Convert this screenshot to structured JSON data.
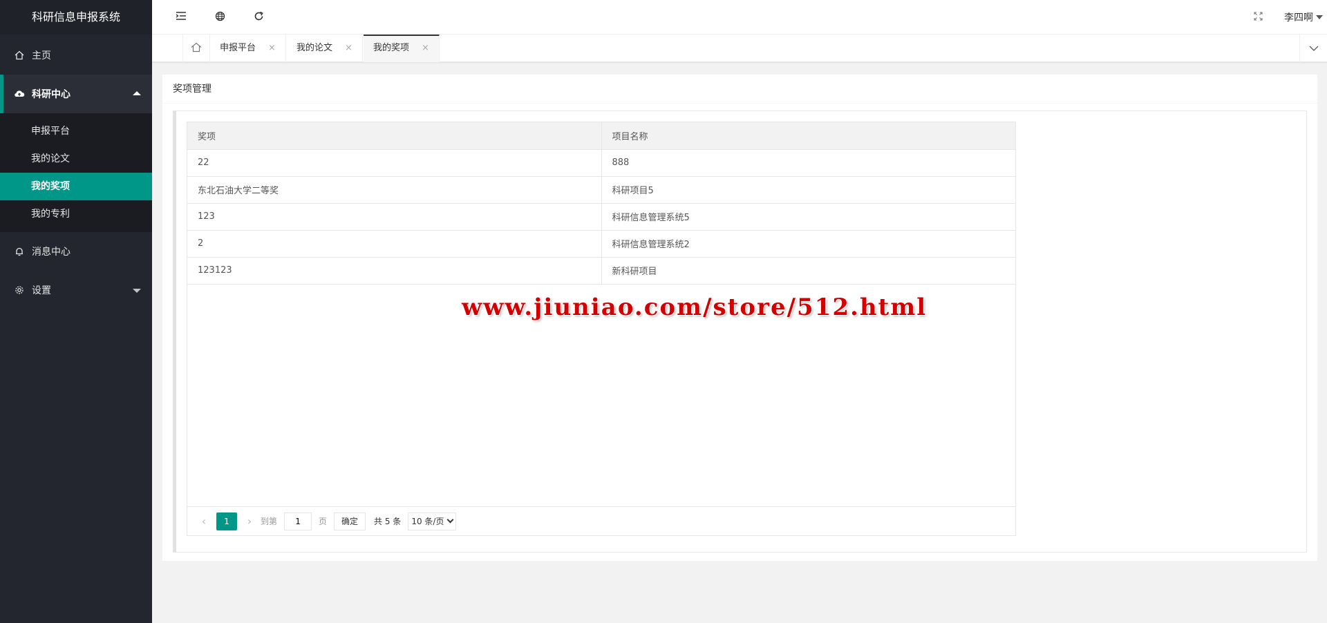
{
  "app": {
    "title": "科研信息申报系统"
  },
  "sidebar": {
    "items": [
      {
        "label": "主页",
        "icon": "home-icon"
      },
      {
        "label": "科研中心",
        "icon": "cloud-upload-icon",
        "expanded": true,
        "children": [
          {
            "label": "申报平台"
          },
          {
            "label": "我的论文"
          },
          {
            "label": "我的奖项",
            "active": true
          },
          {
            "label": "我的专利"
          }
        ]
      },
      {
        "label": "消息中心",
        "icon": "bell-icon"
      },
      {
        "label": "设置",
        "icon": "gear-icon"
      }
    ]
  },
  "header": {
    "user": "李四啊"
  },
  "tabs": [
    {
      "label": "申报平台",
      "close": "×"
    },
    {
      "label": "我的论文",
      "close": "×"
    },
    {
      "label": "我的奖项",
      "close": "×",
      "active": true
    }
  ],
  "panel": {
    "title": "奖项管理"
  },
  "table": {
    "columns": [
      "奖项",
      "项目名称"
    ],
    "rows": [
      [
        "22",
        "888"
      ],
      [
        "东北石油大学二等奖",
        "科研项目5"
      ],
      [
        "123",
        "科研信息管理系统5"
      ],
      [
        "2",
        "科研信息管理系统2"
      ],
      [
        "123123",
        "新科研项目"
      ]
    ]
  },
  "pager": {
    "current": "1",
    "goto_label": "到第",
    "page_input": "1",
    "page_unit": "页",
    "confirm": "确定",
    "total": "共 5 条",
    "page_size": "10 条/页"
  },
  "watermark": "www.jiuniao.com/store/512.html",
  "colors": {
    "accent": "#009688",
    "sidebar_bg": "#23262e",
    "watermark": "#d40000"
  }
}
